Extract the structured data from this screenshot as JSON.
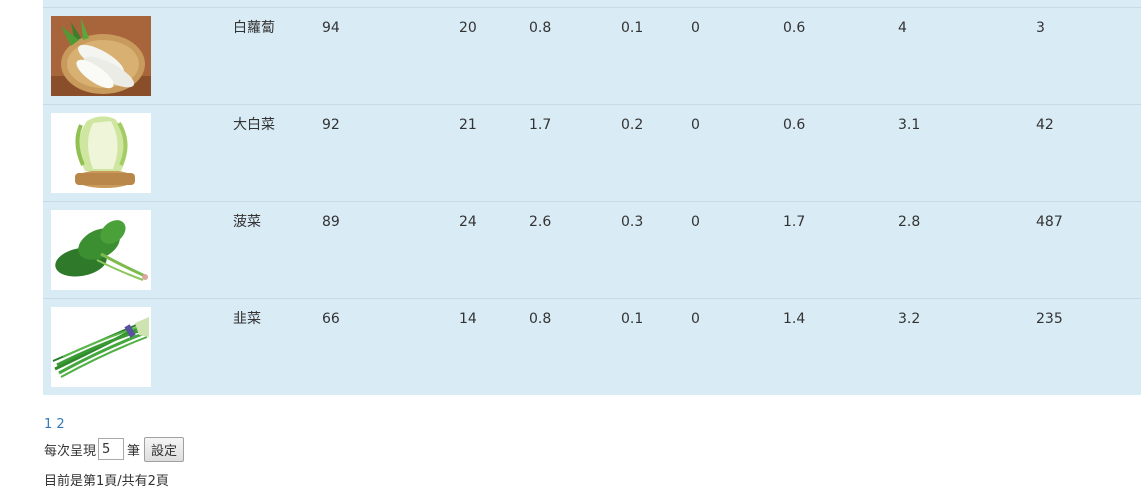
{
  "rows": [
    {
      "name": "白蘿蔔",
      "v1": "94",
      "v2": "20",
      "v3": "0.8",
      "v4": "0.1",
      "v5": "0",
      "v6": "0.6",
      "v7": "4",
      "v8": "3",
      "image": "daikon-radish"
    },
    {
      "name": "大白菜",
      "v1": "92",
      "v2": "21",
      "v3": "1.7",
      "v4": "0.2",
      "v5": "0",
      "v6": "0.6",
      "v7": "3.1",
      "v8": "42",
      "image": "napa-cabbage"
    },
    {
      "name": "菠菜",
      "v1": "89",
      "v2": "24",
      "v3": "2.6",
      "v4": "0.3",
      "v5": "0",
      "v6": "1.7",
      "v7": "2.8",
      "v8": "487",
      "image": "spinach"
    },
    {
      "name": "韭菜",
      "v1": "66",
      "v2": "14",
      "v3": "0.8",
      "v4": "0.1",
      "v5": "0",
      "v6": "1.4",
      "v7": "3.2",
      "v8": "235",
      "image": "chinese-chives"
    }
  ],
  "pagination": {
    "pages": [
      "1",
      "2"
    ]
  },
  "page_size": {
    "prefix": "每次呈現",
    "value": "5",
    "suffix": "筆",
    "button_label": "設定"
  },
  "status_text": "目前是第1頁/共有2頁",
  "colors": {
    "table_background": "#d9ebf5",
    "row_divider": "#c6dbe8",
    "link": "#337ab7"
  }
}
